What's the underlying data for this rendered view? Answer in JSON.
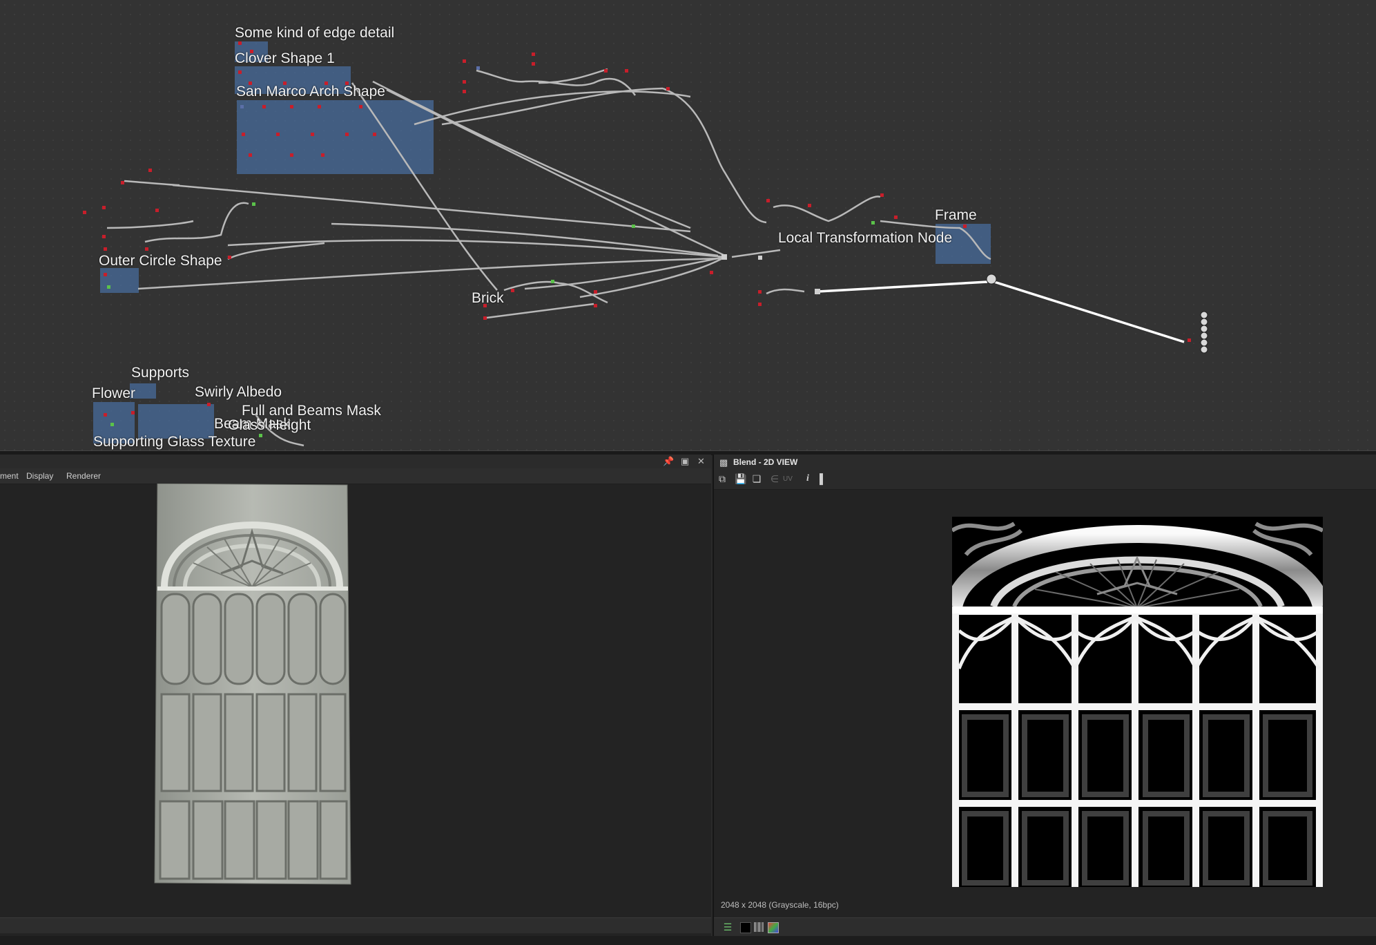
{
  "graph": {
    "frames": [
      {
        "label": "Some kind of edge detail"
      },
      {
        "label": "Clover Shape 1"
      },
      {
        "label": "San Marco Arch Shape"
      },
      {
        "label": "Outer Circle Shape"
      },
      {
        "label": "Brick"
      },
      {
        "label": "Local Transformation Node"
      },
      {
        "label": "Frame"
      },
      {
        "label": "Supports"
      },
      {
        "label": "Flower"
      },
      {
        "label": "Swirly Albedo"
      },
      {
        "label": "Full and Beams Mask"
      },
      {
        "label": "Beam Mask"
      },
      {
        "label": "Glass Height"
      },
      {
        "label": "Supporting Glass Texture"
      }
    ]
  },
  "view3d": {
    "menu": [
      "ment",
      "Display",
      "Renderer"
    ],
    "icons": [
      "pin-icon",
      "maximize-icon",
      "close-icon"
    ]
  },
  "view2d": {
    "title": "Blend - 2D VIEW",
    "uv_label": "UV",
    "info_label": "i",
    "status": "2048 x 2048 (Grayscale, 16bpc)"
  },
  "colors": {
    "graph_bg": "#333333",
    "frame_fill": "#486ea0",
    "port_red": "#c81e2a",
    "port_blue": "#5b6fa8",
    "panel_bg": "#232323"
  }
}
